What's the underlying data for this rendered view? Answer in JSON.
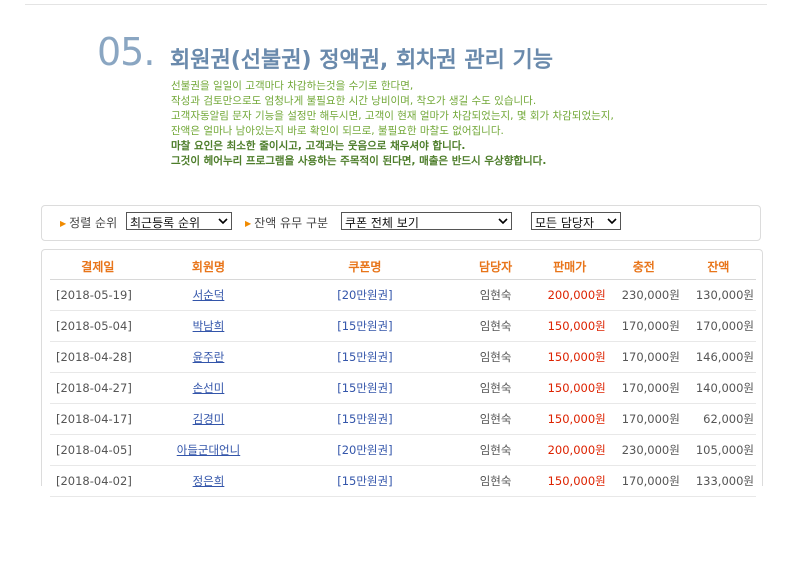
{
  "section": {
    "number": "05.",
    "title": "회원권(선불권) 정액권, 회차권 관리 기능"
  },
  "description": [
    {
      "text": "선불권을 일일이 고객마다 차감하는것을 수기로 한다면,",
      "bold": false
    },
    {
      "text": "작성과 검토만으로도 엄청나게 불필요한 시간 낭비이며, 착오가 생길 수도 있습니다.",
      "bold": false
    },
    {
      "text": "고객자동알림 문자 기능을 설정만 해두시면, 고객이 현재 얼마가 차감되었는지, 몇 회가 차감되었는지,",
      "bold": false
    },
    {
      "text": "잔액은 얼마나 남아있는지 바로 확인이 되므로, 불필요한 마찰도 없어집니다.",
      "bold": false
    },
    {
      "text": "마찰 요인은 최소한 줄이시고, 고객과는 웃음으로 채우셔야 합니다.",
      "bold": true
    },
    {
      "text": "그것이 헤어누리 프로그램을 사용하는 주목적이 된다면, 매출은 반드시 우상향합니다.",
      "bold": true
    }
  ],
  "filters": {
    "sort_label": "정렬 순위",
    "sort_value": "최근등록 순위",
    "balance_label": "잔액 유무 구분",
    "coupon_value": "쿠폰 전체 보기",
    "staff_value": "모든 담당자"
  },
  "table": {
    "headers": [
      "결제일",
      "회원명",
      "쿠폰명",
      "담당자",
      "판매가",
      "충전",
      "잔액"
    ],
    "rows": [
      {
        "date": "[2018-05-19]",
        "name": "서순덕",
        "coupon": "[20만원권]",
        "staff": "임현숙",
        "price": "200,000원",
        "charge": "230,000원",
        "balance": "130,000원"
      },
      {
        "date": "[2018-05-04]",
        "name": "박남희",
        "coupon": "[15만원권]",
        "staff": "임현숙",
        "price": "150,000원",
        "charge": "170,000원",
        "balance": "170,000원"
      },
      {
        "date": "[2018-04-28]",
        "name": "윤주란",
        "coupon": "[15만원권]",
        "staff": "임현숙",
        "price": "150,000원",
        "charge": "170,000원",
        "balance": "146,000원"
      },
      {
        "date": "[2018-04-27]",
        "name": "손선미",
        "coupon": "[15만원권]",
        "staff": "임현숙",
        "price": "150,000원",
        "charge": "170,000원",
        "balance": "140,000원"
      },
      {
        "date": "[2018-04-17]",
        "name": "김경미",
        "coupon": "[15만원권]",
        "staff": "임현숙",
        "price": "150,000원",
        "charge": "170,000원",
        "balance": "62,000원"
      },
      {
        "date": "[2018-04-05]",
        "name": "아들군대언니",
        "coupon": "[20만원권]",
        "staff": "임현숙",
        "price": "200,000원",
        "charge": "230,000원",
        "balance": "105,000원"
      },
      {
        "date": "[2018-04-02]",
        "name": "정은희",
        "coupon": "[15만원권]",
        "staff": "임현숙",
        "price": "150,000원",
        "charge": "170,000원",
        "balance": "133,000원"
      }
    ]
  },
  "colors": {
    "header_text": "#e8751a",
    "price_text": "#dd2200",
    "link_text": "#3355aa",
    "desc_text": "#72a838",
    "title_text": "#6a8aac"
  }
}
